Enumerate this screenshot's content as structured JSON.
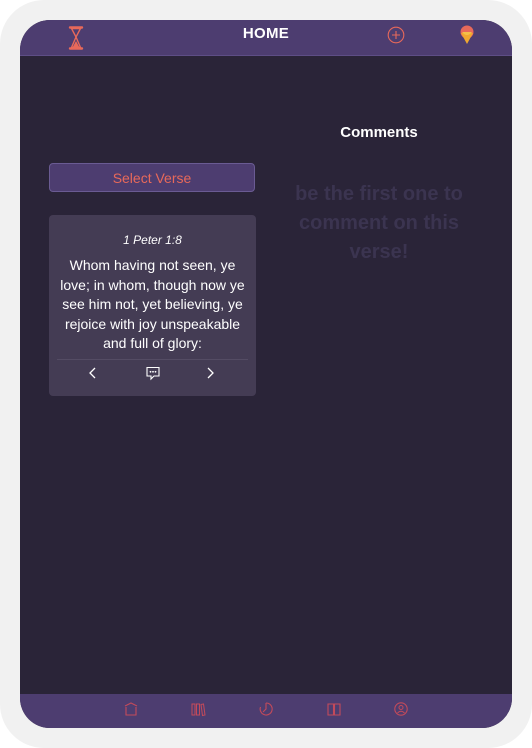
{
  "header": {
    "title": "HOME",
    "icons": [
      "hourglass-icon",
      "add-circle-icon",
      "balloon-icon"
    ]
  },
  "verse_panel": {
    "select_label": "Select Verse",
    "reference": "1 Peter 1:8",
    "text": "Whom having not seen, ye love; in whom, though now ye see him not, yet believing, ye rejoice with joy unspeakable and full of glory:",
    "controls": [
      "chevron-left-icon",
      "comment-icon",
      "chevron-right-icon"
    ]
  },
  "comments": {
    "title": "Comments",
    "empty_message": "be the first one to comment on this verse!"
  },
  "bottom_nav": {
    "items": [
      "home-icon",
      "library-icon",
      "timer-icon",
      "book-icon",
      "profile-icon"
    ]
  },
  "colors": {
    "background": "#2a2438",
    "bar": "#4d3d70",
    "accent": "#e8695a",
    "card": "#443c54"
  }
}
